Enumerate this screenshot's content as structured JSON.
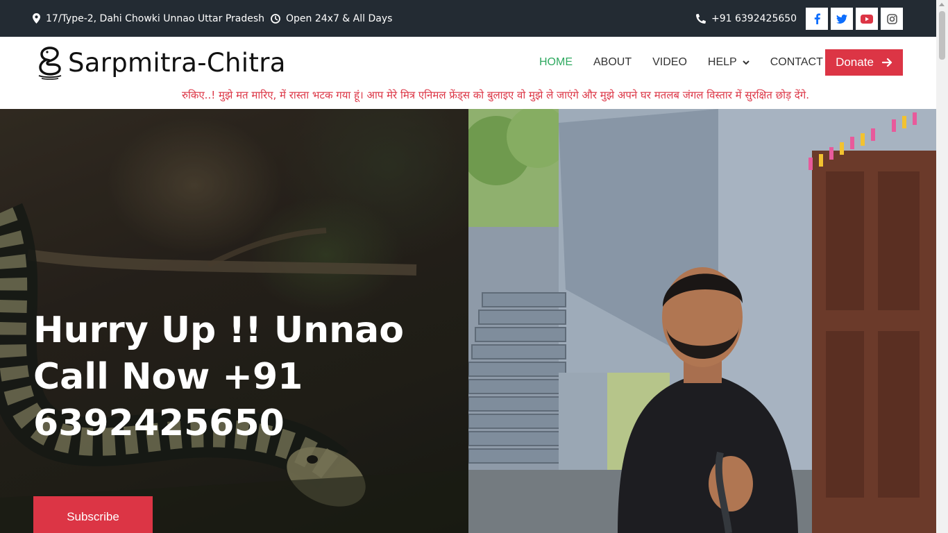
{
  "topbar": {
    "address": "17/Type-2, Dahi Chowki Unnao Uttar Pradesh",
    "hours": "Open 24x7 & All Days",
    "phone": "+91 6392425650",
    "socials": [
      {
        "name": "facebook-icon",
        "color": "#0d6efd"
      },
      {
        "name": "twitter-icon",
        "color": "#0d6efd"
      },
      {
        "name": "youtube-icon",
        "color": "#dc3545"
      },
      {
        "name": "instagram-icon",
        "color": "#555555"
      }
    ]
  },
  "header": {
    "logo_text": "Sarpmitra-Chitra",
    "menu": [
      {
        "label": "HOME",
        "active": true
      },
      {
        "label": "ABOUT",
        "active": false
      },
      {
        "label": "VIDEO",
        "active": false
      },
      {
        "label": "HELP",
        "active": false,
        "has_dropdown": true
      },
      {
        "label": "CONTACT",
        "active": false
      }
    ],
    "donate_label": "Donate",
    "marquee": "रुकिए..! मुझे मत मारिए, में रास्ता भटक गया हूं। आप मेरे मित्र एनिमल फ्रेंड्स को बुलाइए वो मुझे ले जाएंगे और मुझे अपने घर मतलब जंगल विस्तार में सुरक्षित छोड़ देंगे."
  },
  "hero": {
    "title": "Hurry Up !! Unnao Call Now +91 6392425650",
    "subscribe_label": "Subscribe"
  },
  "colors": {
    "topbar_bg": "#232b33",
    "accent_red": "#dc3545",
    "active_green": "#2fa960"
  }
}
